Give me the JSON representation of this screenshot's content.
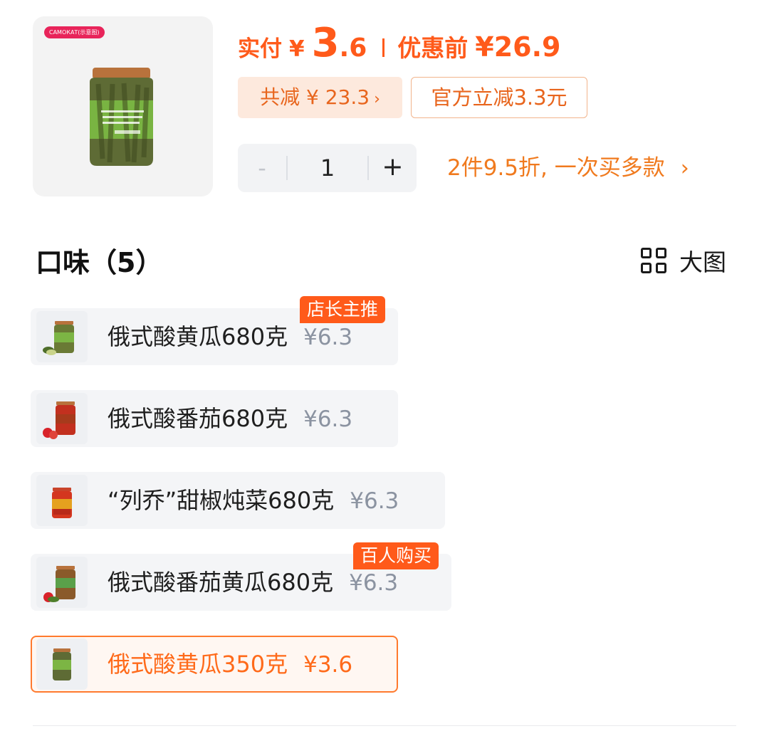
{
  "product": {
    "brand_tag": "САМОКАТ(示意图)",
    "image_icon": "pickle-jar-image"
  },
  "price": {
    "pay_label": "实付",
    "currency": "¥",
    "pay_int": "3",
    "pay_dec": ".6",
    "before_label": "优惠前",
    "before_value": "¥26.9"
  },
  "discount": {
    "total_saved": "共减 ¥ 23.3",
    "official": "官方立减3.3元"
  },
  "quantity": {
    "minus": "-",
    "value": "1",
    "plus": "+"
  },
  "promo": {
    "text": "2件9.5折, 一次买多款",
    "chevron": "›"
  },
  "flavors": {
    "title": "口味（5）",
    "big_view_label": "大图",
    "options": [
      {
        "name": "俄式酸黄瓜680克",
        "price": "¥6.3",
        "badge": "店长主推",
        "selected": false
      },
      {
        "name": "俄式酸番茄680克",
        "price": "¥6.3",
        "badge": "",
        "selected": false
      },
      {
        "name": "“列乔”甜椒炖菜680克",
        "price": "¥6.3",
        "badge": "",
        "selected": false
      },
      {
        "name": "俄式酸番茄黄瓜680克",
        "price": "¥6.3",
        "badge": "百人购买",
        "selected": false
      },
      {
        "name": "俄式酸黄瓜350克",
        "price": "¥3.6",
        "badge": "",
        "selected": true
      }
    ]
  },
  "colors": {
    "accent": "#ff5a1a",
    "accent_text": "#e8651d",
    "chip_bg": "#f4f5f7",
    "muted_price": "#8b93a1"
  }
}
